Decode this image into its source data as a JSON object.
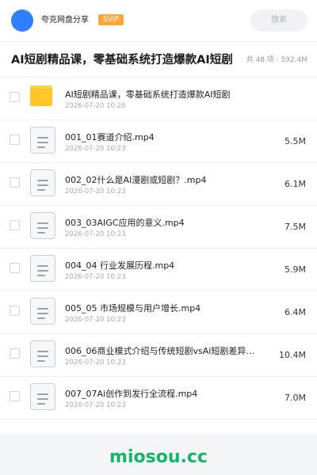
{
  "topbar": {
    "share_name": "夸克网盘分享",
    "badge": "SVIP",
    "search_placeholder": "搜索"
  },
  "header": {
    "title": "AI短剧精品课，零基础系统打造爆款AI短剧",
    "meta": "共 48 项 · 592.4M"
  },
  "files": [
    {
      "type": "folder",
      "name": "AI短剧精品课，零基础系统打造爆款AI短剧",
      "date": "2026-07-20 10:26",
      "size": ""
    },
    {
      "type": "file",
      "name": "001_01赛道介绍.mp4",
      "date": "2026-07-20 10:23",
      "size": "5.5M"
    },
    {
      "type": "file",
      "name": "002_02什么是AI漫剧或短剧？.mp4",
      "date": "2026-07-20 10:23",
      "size": "6.1M"
    },
    {
      "type": "file",
      "name": "003_03AIGC应用的意义.mp4",
      "date": "2026-07-20 10:23",
      "size": "7.5M"
    },
    {
      "type": "file",
      "name": "004_04 行业发展历程.mp4",
      "date": "2026-07-20 10:23",
      "size": "5.9M"
    },
    {
      "type": "file",
      "name": "005_05 市场规模与用户增长.mp4",
      "date": "2026-07-20 10:23",
      "size": "6.4M"
    },
    {
      "type": "file",
      "name": "006_06商业模式介绍与传统短剧vsAi短剧差异…",
      "date": "2026-07-20 10:23",
      "size": "10.4M"
    },
    {
      "type": "file",
      "name": "007_07Ai创作到发行全流程.mp4",
      "date": "2026-07-20 10:23",
      "size": "7.0M"
    }
  ],
  "watermark": "miosou.cc",
  "colors": {
    "accent": "#2f80ff",
    "badge": "#ffa63a",
    "folder": "#ffc629",
    "watermark": "#18b36b"
  }
}
